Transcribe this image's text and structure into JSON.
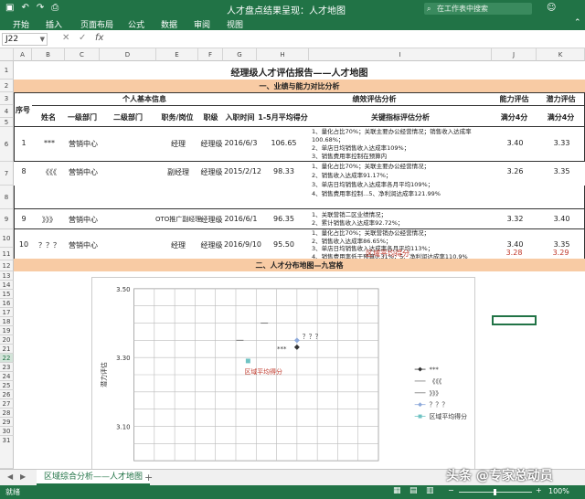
{
  "titlebar": {
    "title": "人才盘点结果呈现：人才地图",
    "search_placeholder": "在工作表中搜索",
    "qat_icons": [
      "save-icon",
      "undo-icon",
      "redo-icon",
      "print-icon"
    ]
  },
  "ribbon": {
    "tabs": [
      "开始",
      "插入",
      "页面布局",
      "公式",
      "数据",
      "审阅",
      "视图"
    ]
  },
  "formula_bar": {
    "name_box": "J22",
    "fx": "fx",
    "value": ""
  },
  "columns": [
    "A",
    "B",
    "C",
    "D",
    "E",
    "F",
    "G",
    "H",
    "I",
    "J",
    "K"
  ],
  "rows": [
    "1",
    "2",
    "3",
    "4",
    "5",
    "6",
    "7",
    "8",
    "9",
    "10",
    "11",
    "12",
    "13",
    "14",
    "15",
    "16",
    "17",
    "18",
    "19",
    "20",
    "21",
    "22",
    "23",
    "24",
    "25",
    "26",
    "27",
    "28",
    "29",
    "30",
    "31"
  ],
  "sheet": {
    "report_title": "经理级人才评估报告——人才地图",
    "section1": "一、业绩与能力对比分析",
    "section2": "二、人才分布地图—九宫格",
    "group_basic": "个人基本信息",
    "group_perf": "绩效评估分析",
    "group_ability": "能力评估",
    "group_potential": "潜力评估",
    "headers": {
      "no": "序号",
      "name": "姓名",
      "dept1": "一级部门",
      "dept2": "二级部门",
      "position": "职务/岗位",
      "level": "职级",
      "entry": "入职时间",
      "perf_avg": "1-5月平均得分",
      "kpi": "关键指标评估分析",
      "ability_score": "满分4分",
      "potential_score": "满分4分"
    },
    "records": [
      {
        "no": "1",
        "name": "***",
        "dept1": "营销中心",
        "dept2": "",
        "position": "经理",
        "level": "经理级",
        "entry": "2016/6/3",
        "perf": "106.65",
        "kpi": [
          "1、量化占比70%；关联主要办公经营情况；销售收入达成率",
          "100.68%；",
          "2、单店日均销售收入达成率109%；",
          "3、销售费用率控制在预算内"
        ],
        "ability": "3.40",
        "potential": "3.33"
      },
      {
        "no": "8",
        "name": "《《《",
        "dept1": "营销中心",
        "dept2": "",
        "position": "副经理",
        "level": "经理级",
        "entry": "2015/2/12",
        "perf": "98.33",
        "kpi": [
          "1、量化占比70%；关联主要办公经营情况；",
          "2、销售收入达成率91.17%；",
          "3、单店日均销售收入达成率各月平均109%；",
          "4、销售费用率控制...5、净利润达成率121.99%"
        ],
        "ability": "3.26",
        "potential": "3.35"
      },
      {
        "no": "9",
        "name": "》》》",
        "dept1": "营销中心",
        "dept2": "OTO推广副经理",
        "position": "",
        "level": "经理级",
        "entry": "2016/6/1",
        "perf": "96.35",
        "kpi": [
          "1、关联营销二区业绩情况；",
          "2、累计销售收入达成率92.72%；"
        ],
        "ability": "3.32",
        "potential": "3.40"
      },
      {
        "no": "10",
        "name": "？？？",
        "dept1": "营销中心",
        "dept2": "",
        "position": "经理",
        "level": "经理级",
        "entry": "2016/9/10",
        "perf": "95.50",
        "kpi": [
          "1、量化占比70%；关联营销办公经营情况；",
          "2、销售收入达成率86.65%；",
          "3、单店日均销售收入达成率各月平均113%；",
          "4、销售费用率低于预算0.31%；5、净利润达成率110.9%"
        ],
        "ability": "3.40",
        "potential": "3.35"
      }
    ],
    "region_avg_label": "区域平均得分",
    "region_avg_ability": "3.28",
    "region_avg_potential": "3.29"
  },
  "chart_data": {
    "type": "scatter",
    "title": "",
    "xlabel": "",
    "ylabel": "潜力评估",
    "yticks": [
      "3.50",
      "3.30",
      "3.10"
    ],
    "ylim": [
      3.0,
      3.5
    ],
    "grid": true,
    "legend_position": "right",
    "series": [
      {
        "name": "***",
        "x": [
          3.4
        ],
        "y": [
          3.33
        ],
        "marker": "diamond",
        "color": "#333333"
      },
      {
        "name": "《《《",
        "x": [
          3.26
        ],
        "y": [
          3.35
        ],
        "marker": "dash",
        "color": "#777777"
      },
      {
        "name": "》》》",
        "x": [
          3.32
        ],
        "y": [
          3.4
        ],
        "marker": "dash",
        "color": "#777777"
      },
      {
        "name": "？？？",
        "x": [
          3.4
        ],
        "y": [
          3.35
        ],
        "marker": "diamond",
        "color": "#8eaadb"
      },
      {
        "name": "区域平均得分",
        "x": [
          3.28
        ],
        "y": [
          3.29
        ],
        "marker": "square",
        "color": "#6fc3c3"
      }
    ],
    "point_labels": [
      "***",
      "？？？",
      "区域平均得分"
    ]
  },
  "sheet_tabs": [
    "区域综合分析——人才地图"
  ],
  "status": {
    "left": "就绪",
    "zoom": "100%"
  },
  "watermark": "头条 @专家总动员"
}
